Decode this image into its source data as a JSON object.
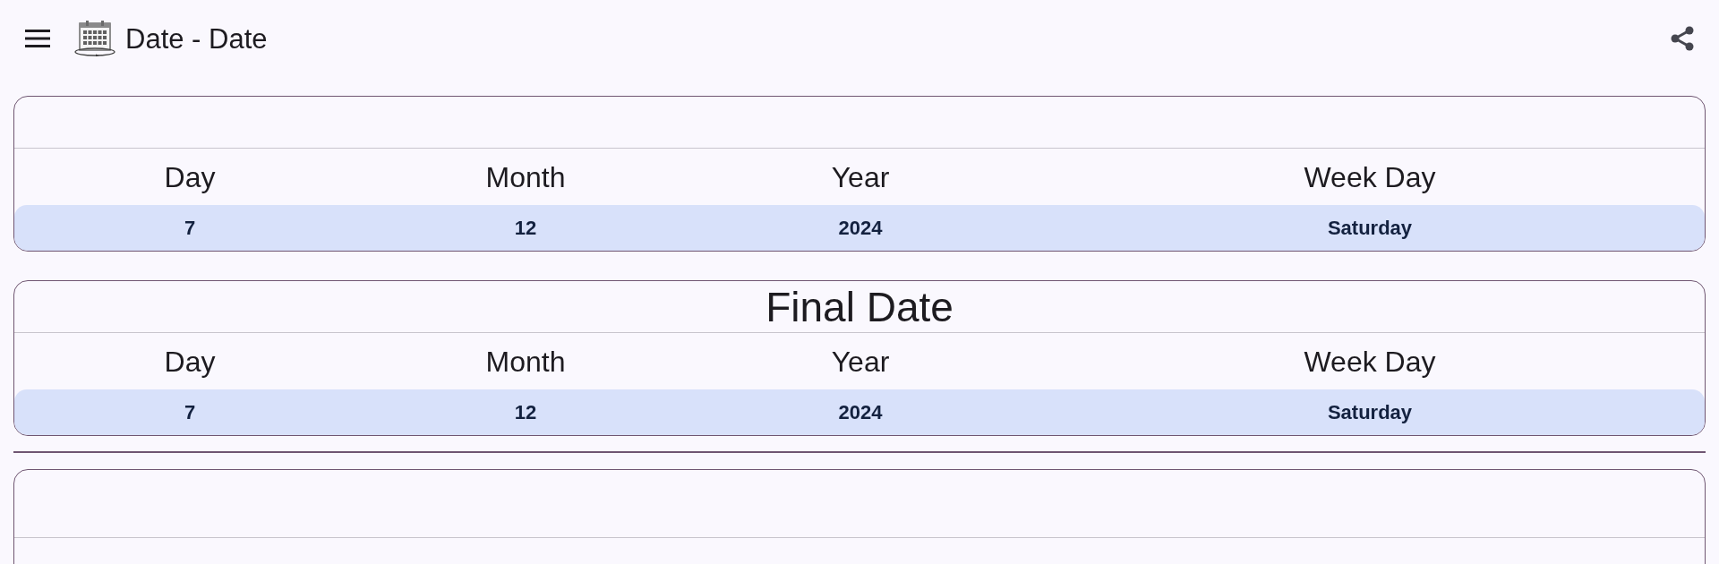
{
  "app_bar": {
    "title": "Date - Date"
  },
  "sections": [
    {
      "kind": "card",
      "columns": [
        "Day",
        "Month",
        "Year",
        "Week Day"
      ],
      "row": [
        "7",
        "12",
        "2024",
        "Saturday"
      ]
    },
    {
      "kind": "card",
      "title": "Final Date",
      "columns": [
        "Day",
        "Month",
        "Year",
        "Week Day"
      ],
      "row": [
        "7",
        "12",
        "2024",
        "Saturday"
      ]
    },
    {
      "kind": "divider"
    },
    {
      "kind": "card"
    }
  ]
}
